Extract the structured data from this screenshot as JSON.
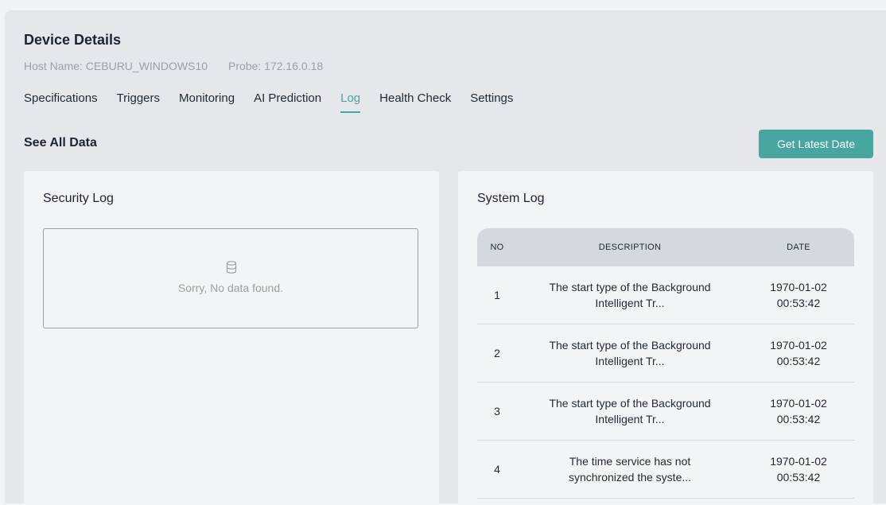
{
  "header": {
    "title": "Device Details",
    "host_name": "Host Name: CEBURU_WINDOWS10",
    "probe": "Probe: 172.16.0.18"
  },
  "tabs": [
    {
      "label": "Specifications",
      "active": false
    },
    {
      "label": "Triggers",
      "active": false
    },
    {
      "label": "Monitoring",
      "active": false
    },
    {
      "label": "AI Prediction",
      "active": false
    },
    {
      "label": "Log",
      "active": true
    },
    {
      "label": "Health Check",
      "active": false
    },
    {
      "label": "Settings",
      "active": false
    }
  ],
  "section": {
    "title": "See All Data",
    "button_label": "Get Latest Date"
  },
  "security_log": {
    "title": "Security Log",
    "empty_text": "Sorry, No data found.",
    "empty_icon": "database-icon"
  },
  "system_log": {
    "title": "System Log",
    "columns": [
      "NO",
      "DESCRIPTION",
      "DATE"
    ],
    "rows": [
      {
        "no": "1",
        "desc_line1": "The start type of the Background",
        "desc_line2": "Intelligent Tr...",
        "date_line1": "1970-01-02",
        "date_line2": "00:53:42"
      },
      {
        "no": "2",
        "desc_line1": "The start type of the Background",
        "desc_line2": "Intelligent Tr...",
        "date_line1": "1970-01-02",
        "date_line2": "00:53:42"
      },
      {
        "no": "3",
        "desc_line1": "The start type of the Background",
        "desc_line2": "Intelligent Tr...",
        "date_line1": "1970-01-02",
        "date_line2": "00:53:42"
      },
      {
        "no": "4",
        "desc_line1": "The time service has not",
        "desc_line2": "synchronized the syste...",
        "date_line1": "1970-01-02",
        "date_line2": "00:53:42"
      }
    ]
  },
  "colors": {
    "accent": "#47a6a0",
    "background": "#e6e7eb",
    "card": "#f3f4f6"
  }
}
